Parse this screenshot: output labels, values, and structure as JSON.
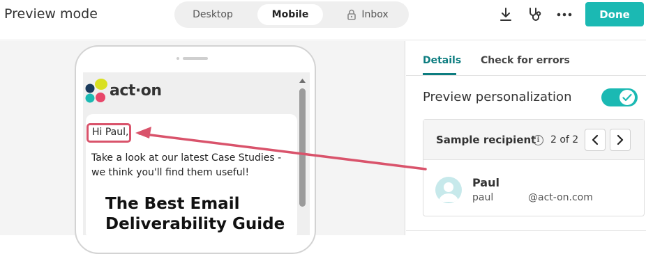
{
  "header": {
    "title": "Preview mode",
    "view_tabs": [
      "Desktop",
      "Mobile",
      "Inbox"
    ],
    "active_view": "Mobile",
    "done_label": "Done"
  },
  "email": {
    "logo_text": "act·on",
    "greeting": "Hi Paul,",
    "body": "Take a look at our latest Case Studies - we think you'll find them useful!",
    "headline": "The Best Email Deliverability Guide"
  },
  "panel": {
    "tabs": [
      "Details",
      "Check for errors"
    ],
    "active_tab": "Details",
    "personalization_label": "Preview personalization",
    "personalization_on": true,
    "sample_label": "Sample recipient",
    "sample_count": "2 of 2",
    "recipient": {
      "name": "Paul",
      "first": "paul",
      "email": "@act-on.com"
    }
  },
  "colors": {
    "accent": "#1bb9b3",
    "tab_active": "#0d7d80",
    "highlight": "#d9536b"
  }
}
